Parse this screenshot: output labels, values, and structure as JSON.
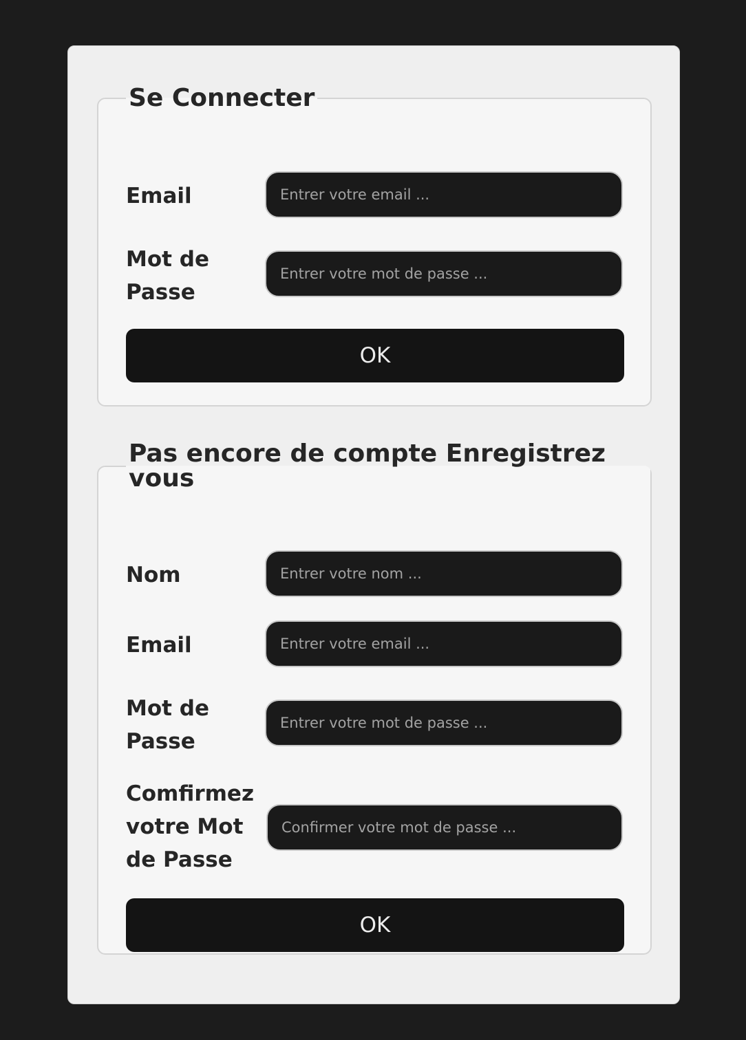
{
  "login": {
    "title": "Se Connecter",
    "email_label": "Email",
    "email_placeholder": "Entrer votre email ...",
    "password_label": "Mot de Passe",
    "password_placeholder": "Entrer votre mot de passe ...",
    "ok_label": "OK"
  },
  "register": {
    "title": "Pas encore de compte Enregistrez vous",
    "name_label": "Nom",
    "name_placeholder": "Entrer votre nom ...",
    "email_label": "Email",
    "email_placeholder": "Entrer votre email ...",
    "password_label": "Mot de Passe",
    "password_placeholder": "Entrer votre mot de passe ...",
    "confirm_label": "Comfirmez votre Mot de Passe",
    "confirm_placeholder": "Confirmer votre mot de passe ...",
    "ok_label": "OK"
  },
  "colors": {
    "page_background": "#1c1c1c",
    "panel_background": "#efefef",
    "input_background": "#1a1a1a",
    "button_background": "#141414"
  }
}
